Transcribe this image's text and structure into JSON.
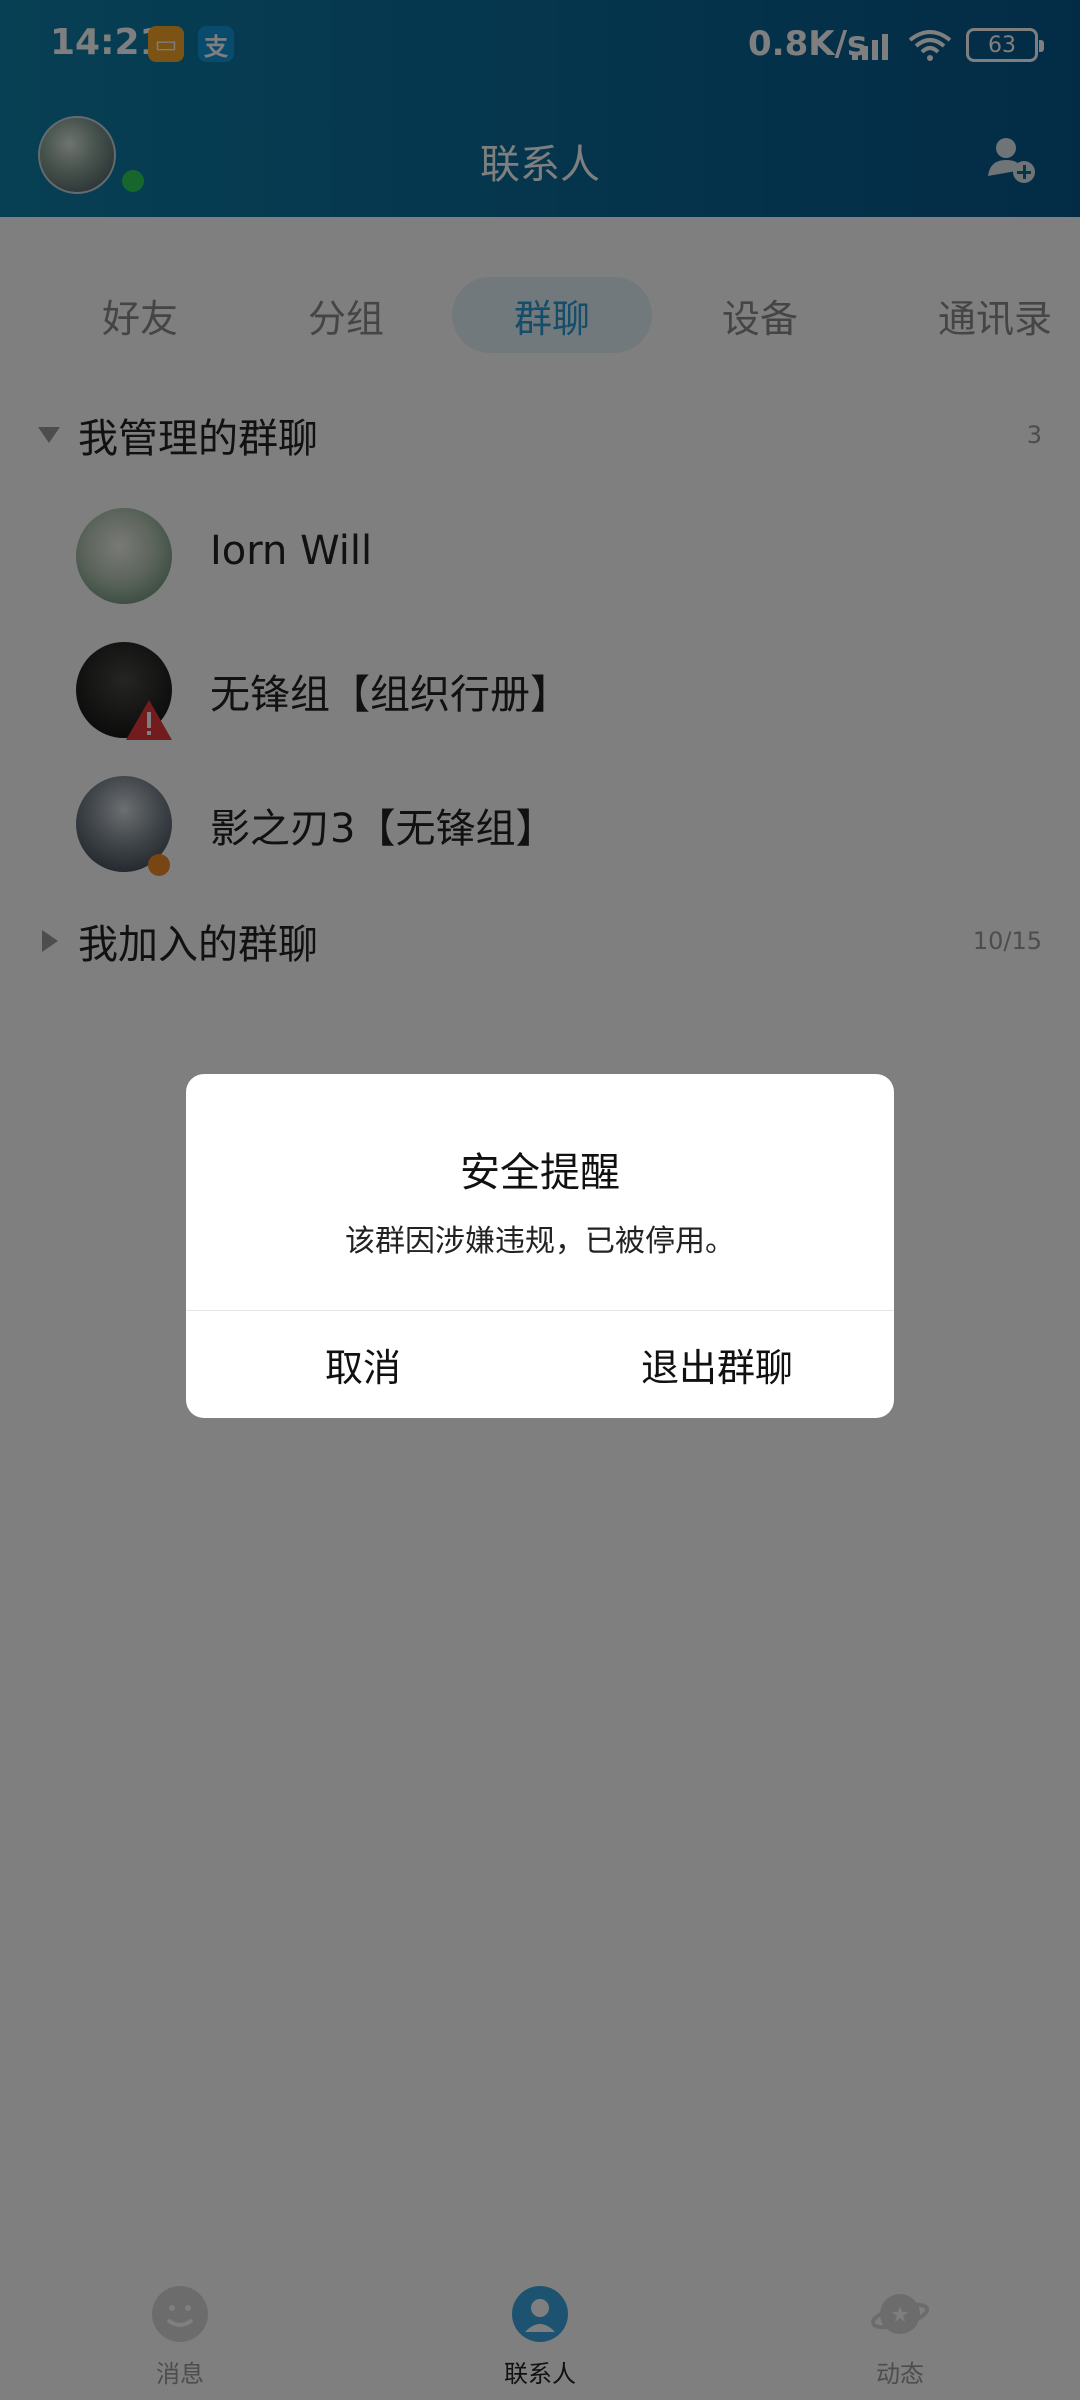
{
  "status_bar": {
    "time": "14:21",
    "network_speed": "0.8K/s",
    "battery": "63",
    "icons": [
      "notes-app-icon",
      "alipay-icon",
      "signal-icon",
      "wifi-icon",
      "battery-icon"
    ],
    "app_icon_notes_glyph": "▭",
    "app_icon_pay_glyph": "支"
  },
  "header": {
    "title": "联系人",
    "add_contact_icon": "add-contact-icon"
  },
  "tabs": {
    "items": [
      "好友",
      "分组",
      "群聊",
      "设备",
      "通讯录"
    ],
    "active": "群聊"
  },
  "groups": {
    "managed": {
      "title": "我管理的群聊",
      "count": "3",
      "items": [
        {
          "name": "Iorn Will"
        },
        {
          "name": "无锋组【组织行册】"
        },
        {
          "name": "影之刃3【无锋组】"
        }
      ]
    },
    "joined": {
      "title": "我加入的群聊",
      "count": "10/15"
    }
  },
  "dialog": {
    "title": "安全提醒",
    "message": "该群因涉嫌违规，已被停用。",
    "cancel_label": "取消",
    "exit_label": "退出群聊"
  },
  "bottom_nav": {
    "items": [
      "消息",
      "联系人",
      "动态"
    ],
    "active": "联系人"
  },
  "colors": {
    "header_gradient_start": "#0f7fa8",
    "header_gradient_end": "#07578c",
    "tab_active_text": "#2b9ad6",
    "tab_active_bg": "#e4f3fb",
    "online_dot": "#2ecc5c",
    "warning_red": "#e5383b"
  }
}
